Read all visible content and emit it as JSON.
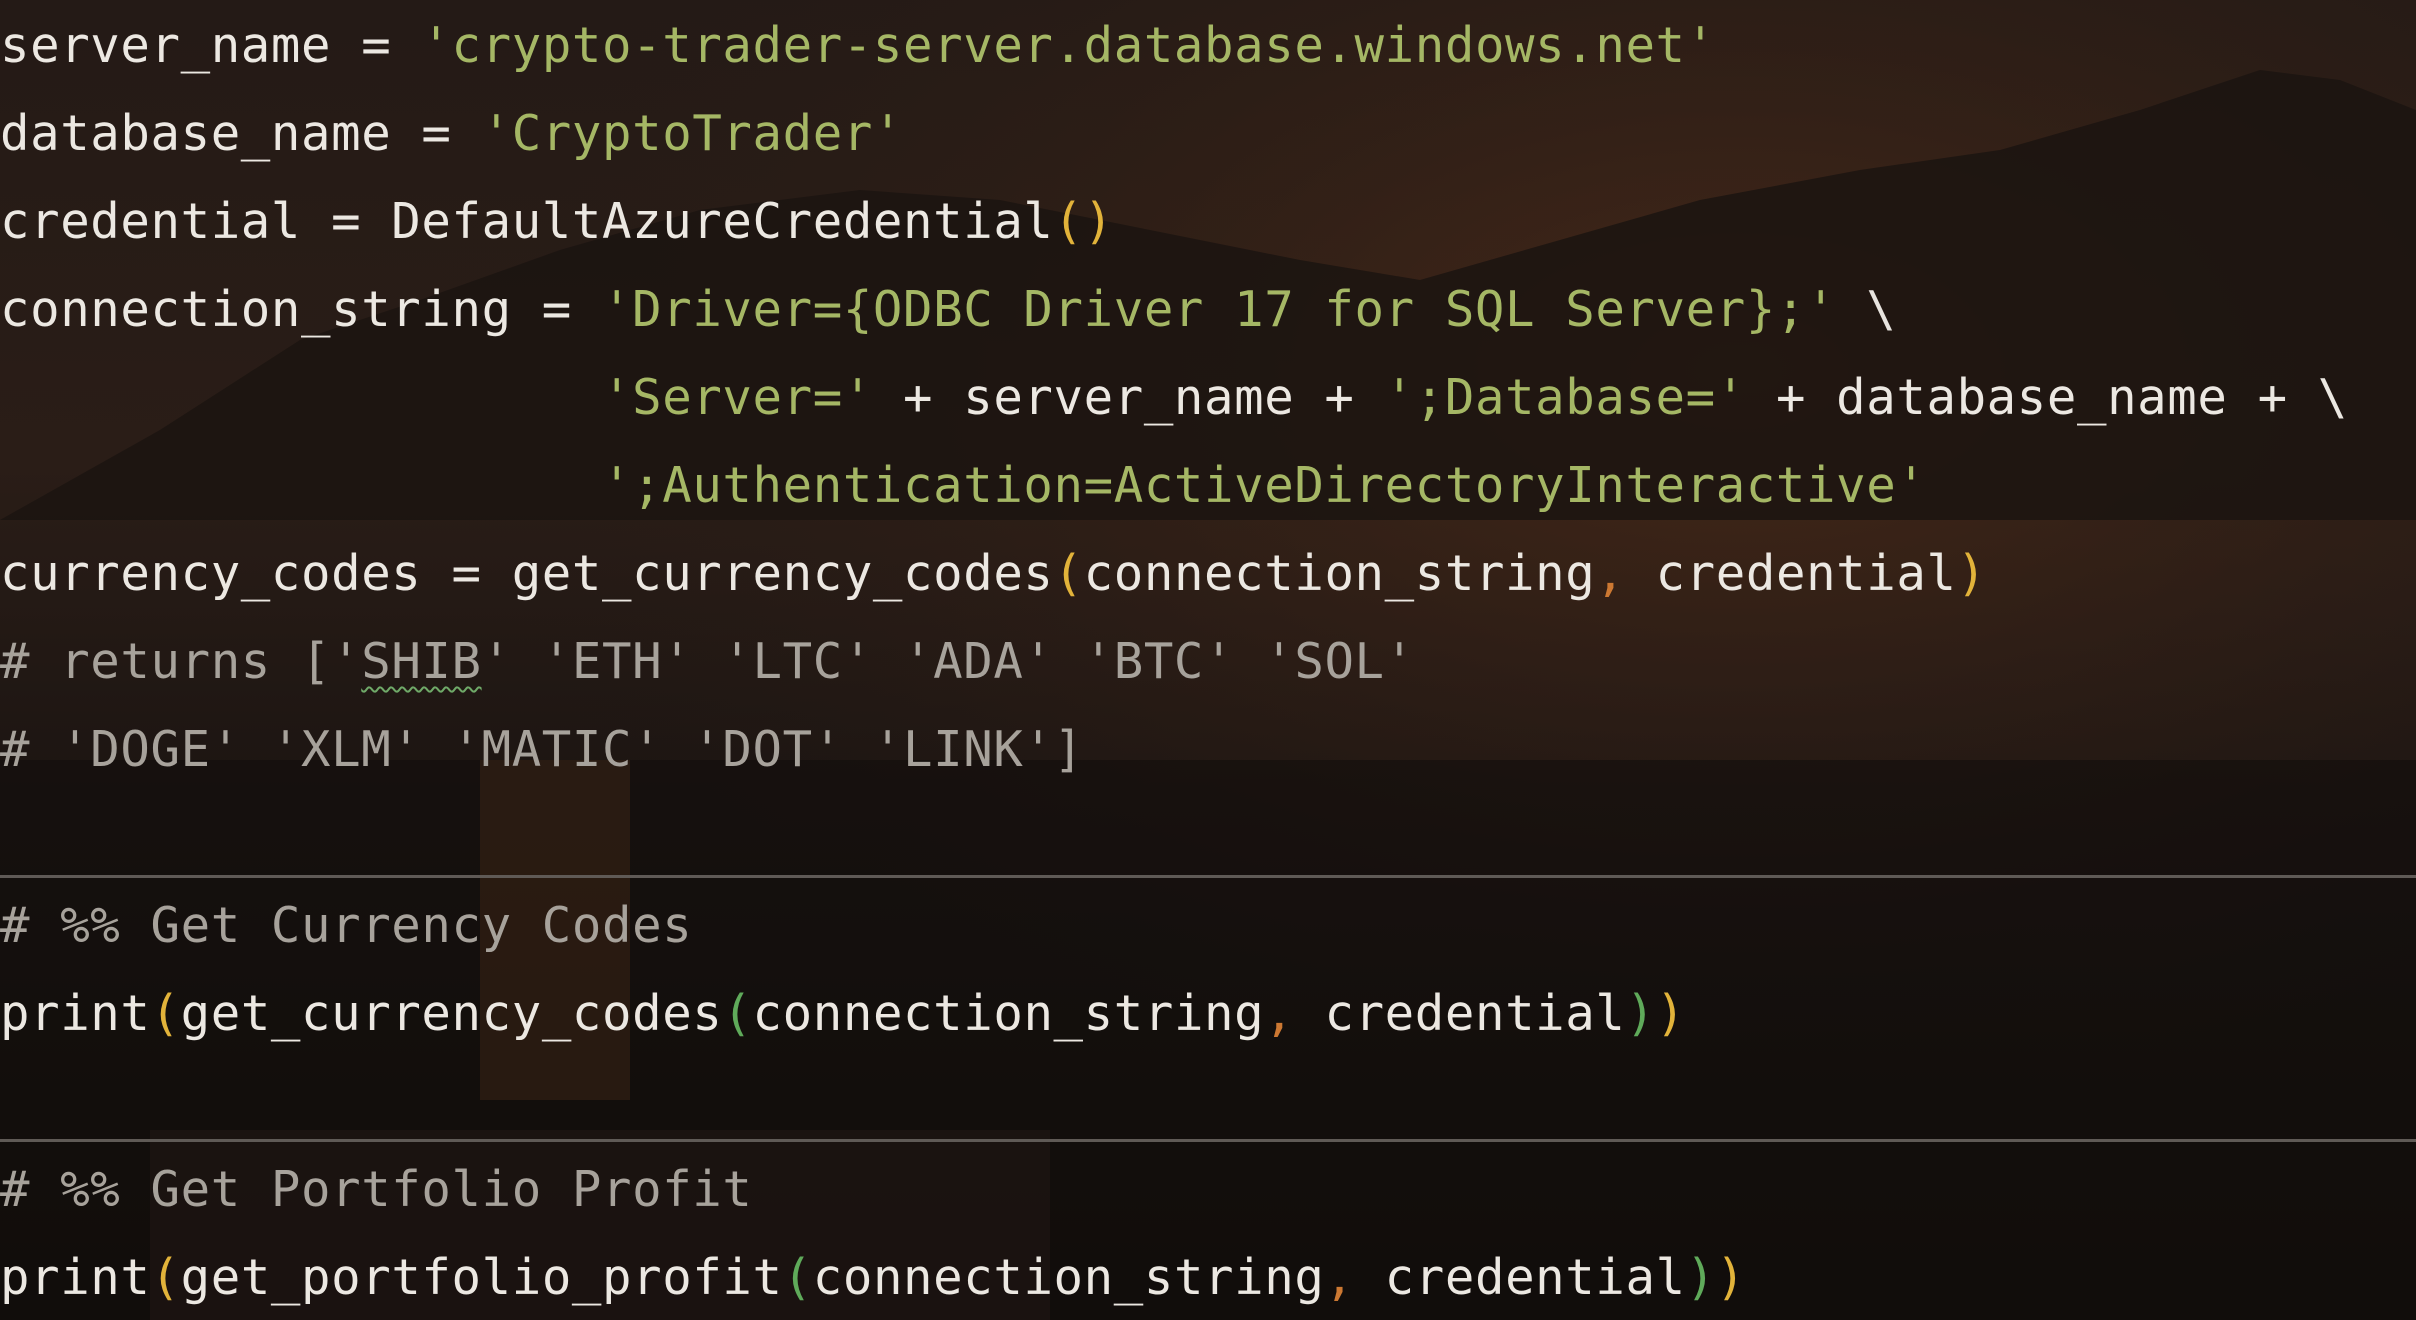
{
  "colors": {
    "identifier": "#ece8e2",
    "string": "#a5b765",
    "comment": "#a7a29b",
    "paren_outer": "#e2b33a",
    "paren_inner": "#5faa5a",
    "comma": "#cc7832",
    "cell_separator": "#5f5a56"
  },
  "code": {
    "l1": {
      "a": "server_name = ",
      "b": "'crypto-trader-server.database.windows.net'"
    },
    "l2": {
      "a": "database_name = ",
      "b": "'CryptoTrader'"
    },
    "l3": {
      "a": "credential = DefaultAzureCredential",
      "b": "(",
      "c": ")"
    },
    "l4": {
      "a": "connection_string = ",
      "b": "'Driver={ODBC Driver 17 for SQL Server};'",
      "c": " \\"
    },
    "l5": {
      "indent": "                    ",
      "a": "'Server='",
      "b": " + server_name + ",
      "c": "';Database='",
      "d": " + database_name + \\"
    },
    "l6": {
      "indent": "                    ",
      "a": "';Authentication=ActiveDirectoryInteractive'"
    },
    "l7": {
      "a": "currency_codes = get_currency_codes",
      "b": "(",
      "c": "connection_string",
      "d": ",",
      "e": " credential",
      "f": ")"
    },
    "l8": {
      "a": "# returns ['",
      "b": "SHIB",
      "c": "' 'ETH' 'LTC' 'ADA' 'BTC' 'SOL'"
    },
    "l9": {
      "a": "# 'DOGE' 'XLM' 'MATIC' 'DOT' 'LINK']"
    },
    "cell1": {
      "header": "# %% Get Currency Codes",
      "a": "print",
      "b": "(",
      "c": "get_currency_codes",
      "d": "(",
      "e": "connection_string",
      "f": ",",
      "g": " credential",
      "h": ")",
      "i": ")"
    },
    "cell2": {
      "header": "# %% Get Portfolio Profit",
      "a": "print",
      "b": "(",
      "c": "get_portfolio_profit",
      "d": "(",
      "e": "connection_string",
      "f": ",",
      "g": " credential",
      "h": ")",
      "i": ")"
    }
  }
}
